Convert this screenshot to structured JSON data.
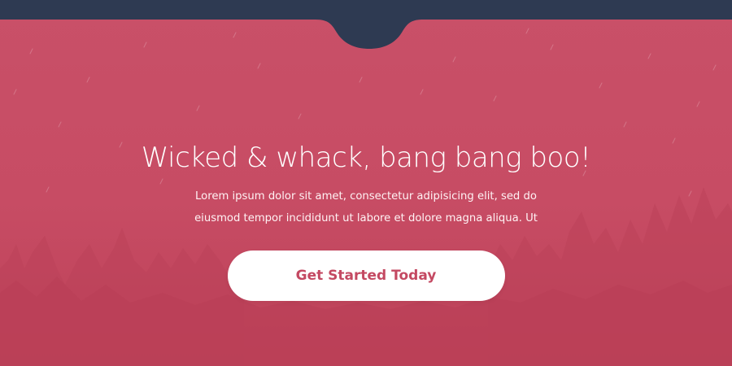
{
  "hero": {
    "headline": "Wicked & whack, bang bang boo!",
    "subtext_line1": "Lorem ipsum dolor sit amet, consectetur adipisicing elit, sed do",
    "subtext_line2": "eiusmod tempor incididunt ut labore et dolore magna aliqua. Ut",
    "cta_label": "Get Started Today"
  },
  "colors": {
    "background": "#c94a62",
    "topbar": "#2e3a52",
    "cta_background": "#ffffff",
    "cta_text": "#c44962"
  }
}
